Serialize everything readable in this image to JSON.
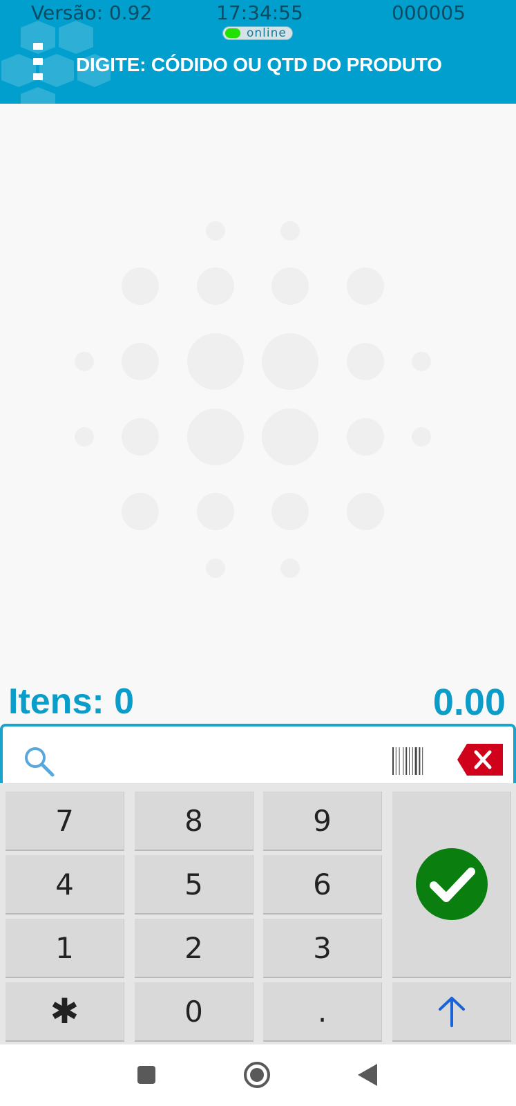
{
  "status_bar": {
    "version": "Versão: 0.92",
    "time": "17:34:55",
    "counter": "000005",
    "connection": "online"
  },
  "header": {
    "menu_icon": "vertical-dots-menu-icon",
    "title": "DIGITE: CÓDIDO OU QTD DO PRODUTO"
  },
  "summary": {
    "items_label": "Itens: 0",
    "total": "0.00"
  },
  "input": {
    "value": "",
    "placeholder": "",
    "search_icon": "search-icon",
    "barcode_icon": "barcode-icon",
    "clear_icon": "backspace-clear-icon"
  },
  "keypad": {
    "keys": [
      "7",
      "8",
      "9",
      "4",
      "5",
      "6",
      "1",
      "2",
      "3",
      "✱",
      "0",
      "."
    ],
    "confirm_icon": "checkmark-circle-icon",
    "up_icon": "arrow-up-icon"
  },
  "navbar": {
    "recent_icon": "square-recent-apps-icon",
    "home_icon": "circle-home-icon",
    "back_icon": "triangle-back-icon"
  },
  "colors": {
    "header_bg": "#009fce",
    "accent_text": "#0a9dc9",
    "online_dot": "#22e000",
    "confirm_green": "#0a7f10",
    "clear_red": "#d0021b",
    "up_arrow": "#1a63d6"
  }
}
